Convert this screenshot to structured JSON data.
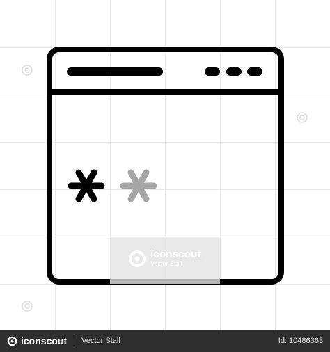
{
  "watermark": {
    "brand": "iconscout",
    "author": "Vector Stall"
  },
  "footer": {
    "brand": "iconscout",
    "author": "Vector Stall",
    "id_label": "Id: 10486363"
  },
  "icon": {
    "semantic": "browser-password-icon",
    "password_chars": [
      "*",
      "*"
    ]
  },
  "colors": {
    "stroke": "#000000",
    "asterisk_primary": "#000000",
    "asterisk_secondary": "#a6a6a6",
    "footer_bg": "#2e2e2e",
    "grid": "#e8e8e8"
  }
}
